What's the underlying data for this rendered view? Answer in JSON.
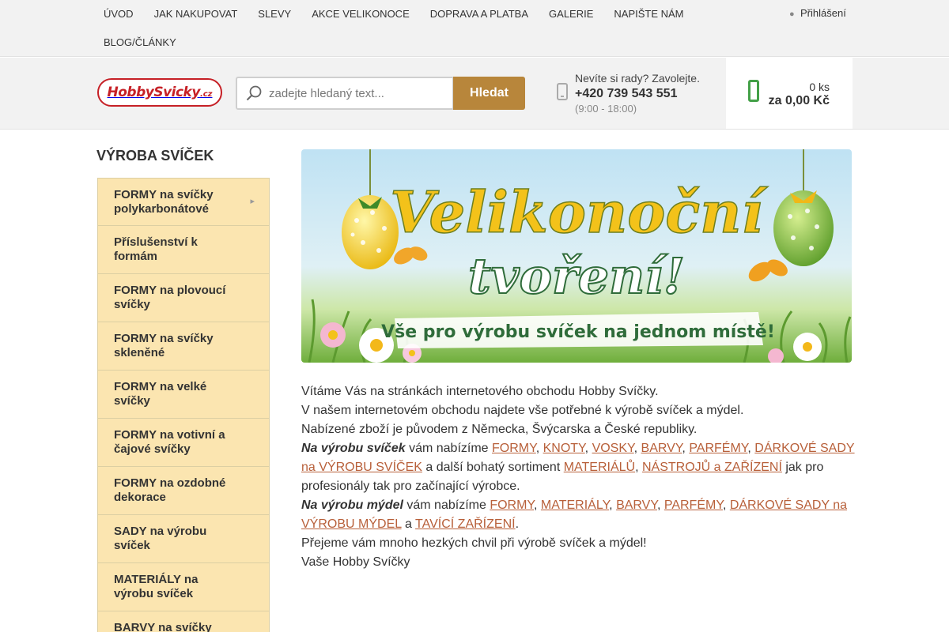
{
  "topnav": {
    "items": [
      "ÚVOD",
      "JAK NAKUPOVAT",
      "SLEVY",
      "AKCE VELIKONOCE",
      "DOPRAVA A PLATBA",
      "GALERIE",
      "NAPIŠTE NÁM",
      "BLOG/ČLÁNKY"
    ],
    "login_label": "Přihlášení",
    "login_icon": "user-icon"
  },
  "header": {
    "logo_brand": "HobbySvicky",
    "logo_tld": ".cz",
    "search_placeholder": "zadejte hledaný text...",
    "search_button": "Hledat",
    "contact_question": "Nevíte si rady? Zavolejte.",
    "contact_phone": "+420 739 543 551",
    "contact_hours": "(9:00 - 18:00)",
    "cart_count": "0 ks",
    "cart_total": "za 0,00 Kč",
    "accent_color": "#b8863b",
    "cart_color": "#43a047"
  },
  "sidebar": {
    "title": "VÝROBA SVÍČEK",
    "items": [
      {
        "label": "FORMY na svíčky polykarbonátové",
        "has_sub": true
      },
      {
        "label": "Příslušenství k formám",
        "has_sub": false
      },
      {
        "label": "FORMY na plovoucí svíčky",
        "has_sub": false
      },
      {
        "label": "FORMY na svíčky skleněné",
        "has_sub": false
      },
      {
        "label": "FORMY na velké svíčky",
        "has_sub": false
      },
      {
        "label": "FORMY na votivní a čajové svíčky",
        "has_sub": false
      },
      {
        "label": "FORMY na ozdobné dekorace",
        "has_sub": false
      },
      {
        "label": "SADY na výrobu svíček",
        "has_sub": false
      },
      {
        "label": "MATERIÁLY na výrobu svíček",
        "has_sub": false
      },
      {
        "label": "BARVY na svíčky",
        "has_sub": true
      }
    ]
  },
  "banner": {
    "line1": "Velikonoční",
    "line2": "tvoření!",
    "line3": "Vše pro výrobu svíček na jednom místě!"
  },
  "intro": {
    "p1": "Vítáme Vás na stránkách internetového obchodu Hobby Svíčky.",
    "p2": "V našem internetovém obchodu najdete vše potřebné k výrobě svíček a mýdel.",
    "p3": "Nabízené zboží je původem z Německa, Švýcarska a České republiky.",
    "candles_lead": "Na výrobu svíček",
    "offer_text": " vám nabízíme ",
    "c_link1": "FORMY",
    "c_link2": "KNOTY",
    "c_link3": "VOSKY",
    "c_link4": "BARVY",
    "c_link5": "PARFÉMY",
    "c_link6": "DÁRKOVÉ SADY na VÝROBU SVÍČEK",
    "c_mid": " a další bohatý sortiment ",
    "c_link7": "MATERIÁLŮ",
    "c_link8": "NÁSTROJŮ a ZAŘÍZENÍ",
    "c_tail": " jak pro profesionály tak pro začínající výrobce.",
    "soap_lead": "Na výrobu mýdel",
    "s_link1": "FORMY",
    "s_link2": "MATERIÁLY",
    "s_link3": "BARVY",
    "s_link4": "PARFÉMY",
    "s_link5": "DÁRKOVÉ SADY na VÝROBU MÝDEL",
    "s_and": " a ",
    "s_link6": "TAVÍCÍ ZAŘÍZENÍ",
    "p_wish": "Přejeme vám mnoho hezkých chvil při výrobě svíček a mýdel!",
    "p_sign": "Vaše Hobby Svíčky",
    "link_color": "#b8603a"
  }
}
